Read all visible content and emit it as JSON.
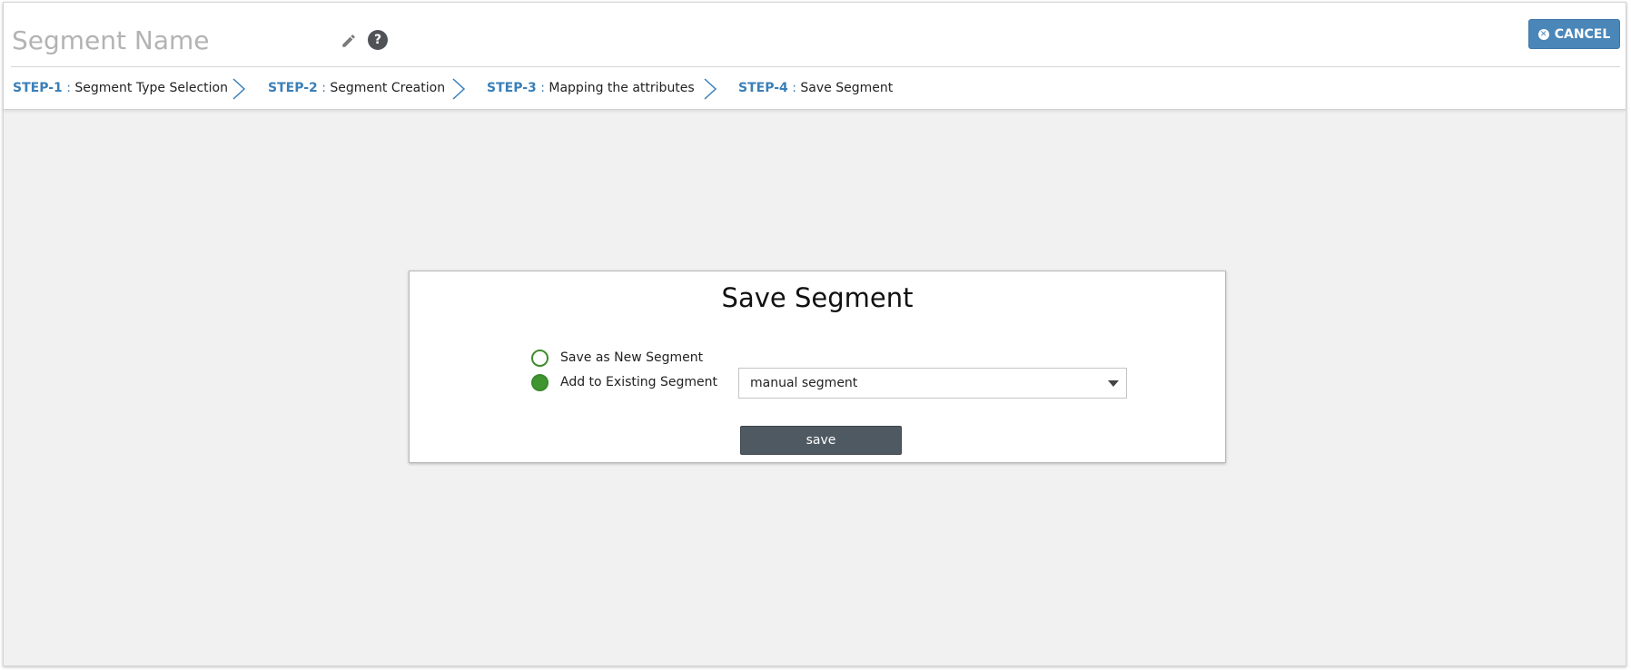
{
  "header": {
    "segment_name_placeholder": "Segment Name",
    "help_label": "?",
    "cancel_label": "CANCEL"
  },
  "steps": [
    {
      "number": "STEP-1",
      "separator": " : ",
      "label": "Segment Type Selection"
    },
    {
      "number": "STEP-2",
      "separator": " : ",
      "label": "Segment Creation"
    },
    {
      "number": "STEP-3",
      "separator": " : ",
      "label": "Mapping the attributes"
    },
    {
      "number": "STEP-4",
      "separator": " : ",
      "label": "Save Segment"
    }
  ],
  "save_panel": {
    "title": "Save Segment",
    "options": [
      {
        "label": "Save as New Segment",
        "checked": false
      },
      {
        "label": "Add to Existing Segment",
        "checked": true
      }
    ],
    "existing_segment": "manual segment",
    "save_label": "save"
  },
  "colors": {
    "accent": "#4a86b8",
    "step_number": "#3a7fb8",
    "radio_green": "#3f9631",
    "save_button": "#4f5961",
    "background": "#f0f1f0"
  }
}
